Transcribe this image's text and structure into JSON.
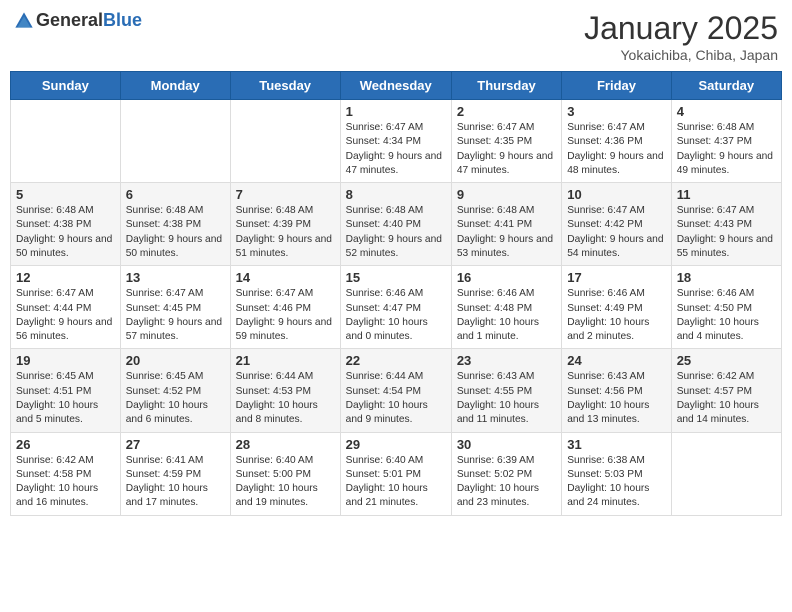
{
  "header": {
    "logo_general": "General",
    "logo_blue": "Blue",
    "month": "January 2025",
    "location": "Yokaichiba, Chiba, Japan"
  },
  "days_of_week": [
    "Sunday",
    "Monday",
    "Tuesday",
    "Wednesday",
    "Thursday",
    "Friday",
    "Saturday"
  ],
  "weeks": [
    [
      {
        "day": "",
        "info": ""
      },
      {
        "day": "",
        "info": ""
      },
      {
        "day": "",
        "info": ""
      },
      {
        "day": "1",
        "info": "Sunrise: 6:47 AM\nSunset: 4:34 PM\nDaylight: 9 hours and 47 minutes."
      },
      {
        "day": "2",
        "info": "Sunrise: 6:47 AM\nSunset: 4:35 PM\nDaylight: 9 hours and 47 minutes."
      },
      {
        "day": "3",
        "info": "Sunrise: 6:47 AM\nSunset: 4:36 PM\nDaylight: 9 hours and 48 minutes."
      },
      {
        "day": "4",
        "info": "Sunrise: 6:48 AM\nSunset: 4:37 PM\nDaylight: 9 hours and 49 minutes."
      }
    ],
    [
      {
        "day": "5",
        "info": "Sunrise: 6:48 AM\nSunset: 4:38 PM\nDaylight: 9 hours and 50 minutes."
      },
      {
        "day": "6",
        "info": "Sunrise: 6:48 AM\nSunset: 4:38 PM\nDaylight: 9 hours and 50 minutes."
      },
      {
        "day": "7",
        "info": "Sunrise: 6:48 AM\nSunset: 4:39 PM\nDaylight: 9 hours and 51 minutes."
      },
      {
        "day": "8",
        "info": "Sunrise: 6:48 AM\nSunset: 4:40 PM\nDaylight: 9 hours and 52 minutes."
      },
      {
        "day": "9",
        "info": "Sunrise: 6:48 AM\nSunset: 4:41 PM\nDaylight: 9 hours and 53 minutes."
      },
      {
        "day": "10",
        "info": "Sunrise: 6:47 AM\nSunset: 4:42 PM\nDaylight: 9 hours and 54 minutes."
      },
      {
        "day": "11",
        "info": "Sunrise: 6:47 AM\nSunset: 4:43 PM\nDaylight: 9 hours and 55 minutes."
      }
    ],
    [
      {
        "day": "12",
        "info": "Sunrise: 6:47 AM\nSunset: 4:44 PM\nDaylight: 9 hours and 56 minutes."
      },
      {
        "day": "13",
        "info": "Sunrise: 6:47 AM\nSunset: 4:45 PM\nDaylight: 9 hours and 57 minutes."
      },
      {
        "day": "14",
        "info": "Sunrise: 6:47 AM\nSunset: 4:46 PM\nDaylight: 9 hours and 59 minutes."
      },
      {
        "day": "15",
        "info": "Sunrise: 6:46 AM\nSunset: 4:47 PM\nDaylight: 10 hours and 0 minutes."
      },
      {
        "day": "16",
        "info": "Sunrise: 6:46 AM\nSunset: 4:48 PM\nDaylight: 10 hours and 1 minute."
      },
      {
        "day": "17",
        "info": "Sunrise: 6:46 AM\nSunset: 4:49 PM\nDaylight: 10 hours and 2 minutes."
      },
      {
        "day": "18",
        "info": "Sunrise: 6:46 AM\nSunset: 4:50 PM\nDaylight: 10 hours and 4 minutes."
      }
    ],
    [
      {
        "day": "19",
        "info": "Sunrise: 6:45 AM\nSunset: 4:51 PM\nDaylight: 10 hours and 5 minutes."
      },
      {
        "day": "20",
        "info": "Sunrise: 6:45 AM\nSunset: 4:52 PM\nDaylight: 10 hours and 6 minutes."
      },
      {
        "day": "21",
        "info": "Sunrise: 6:44 AM\nSunset: 4:53 PM\nDaylight: 10 hours and 8 minutes."
      },
      {
        "day": "22",
        "info": "Sunrise: 6:44 AM\nSunset: 4:54 PM\nDaylight: 10 hours and 9 minutes."
      },
      {
        "day": "23",
        "info": "Sunrise: 6:43 AM\nSunset: 4:55 PM\nDaylight: 10 hours and 11 minutes."
      },
      {
        "day": "24",
        "info": "Sunrise: 6:43 AM\nSunset: 4:56 PM\nDaylight: 10 hours and 13 minutes."
      },
      {
        "day": "25",
        "info": "Sunrise: 6:42 AM\nSunset: 4:57 PM\nDaylight: 10 hours and 14 minutes."
      }
    ],
    [
      {
        "day": "26",
        "info": "Sunrise: 6:42 AM\nSunset: 4:58 PM\nDaylight: 10 hours and 16 minutes."
      },
      {
        "day": "27",
        "info": "Sunrise: 6:41 AM\nSunset: 4:59 PM\nDaylight: 10 hours and 17 minutes."
      },
      {
        "day": "28",
        "info": "Sunrise: 6:40 AM\nSunset: 5:00 PM\nDaylight: 10 hours and 19 minutes."
      },
      {
        "day": "29",
        "info": "Sunrise: 6:40 AM\nSunset: 5:01 PM\nDaylight: 10 hours and 21 minutes."
      },
      {
        "day": "30",
        "info": "Sunrise: 6:39 AM\nSunset: 5:02 PM\nDaylight: 10 hours and 23 minutes."
      },
      {
        "day": "31",
        "info": "Sunrise: 6:38 AM\nSunset: 5:03 PM\nDaylight: 10 hours and 24 minutes."
      },
      {
        "day": "",
        "info": ""
      }
    ]
  ]
}
